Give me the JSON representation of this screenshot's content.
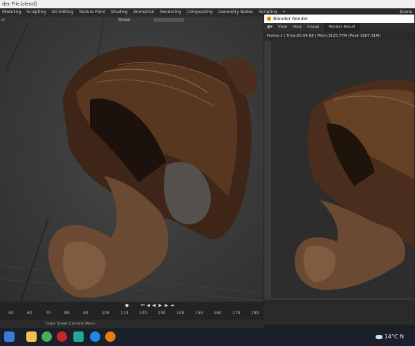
{
  "window_title": "der File.blend]",
  "workspaces": [
    "Modeling",
    "Sculpting",
    "UV Editing",
    "Texture Paint",
    "Shading",
    "Animation",
    "Rendering",
    "Compositing",
    "Geometry Nodes",
    "Scripting"
  ],
  "add_workspace": "+",
  "scene": "Scene",
  "viewport": {
    "mode_label": "ct",
    "orientation": "Global"
  },
  "timeline": {
    "frames": [
      "50",
      "60",
      "70",
      "80",
      "90",
      "100",
      "110",
      "120",
      "130",
      "140",
      "150",
      "160",
      "170",
      "180"
    ]
  },
  "render_window": {
    "title": "Blender Render",
    "menu": [
      "View",
      "View",
      "Image"
    ],
    "image_name": "Render Result",
    "info": "Frame:1 | Time:00:04.88 | Mem:3125.77M (Peak 3187.31M)"
  },
  "statusbar": {
    "context_menu": "Dope Sheet Context Menu"
  },
  "taskbar": {
    "temperature": "14°C",
    "trailing": "N"
  },
  "colors": {
    "hair_dark": "#2a1a10",
    "hair_mid": "#5a3a22",
    "hair_light": "#8a6040",
    "fur": "#6b4a33",
    "blender_orange": "#e87d0d"
  }
}
